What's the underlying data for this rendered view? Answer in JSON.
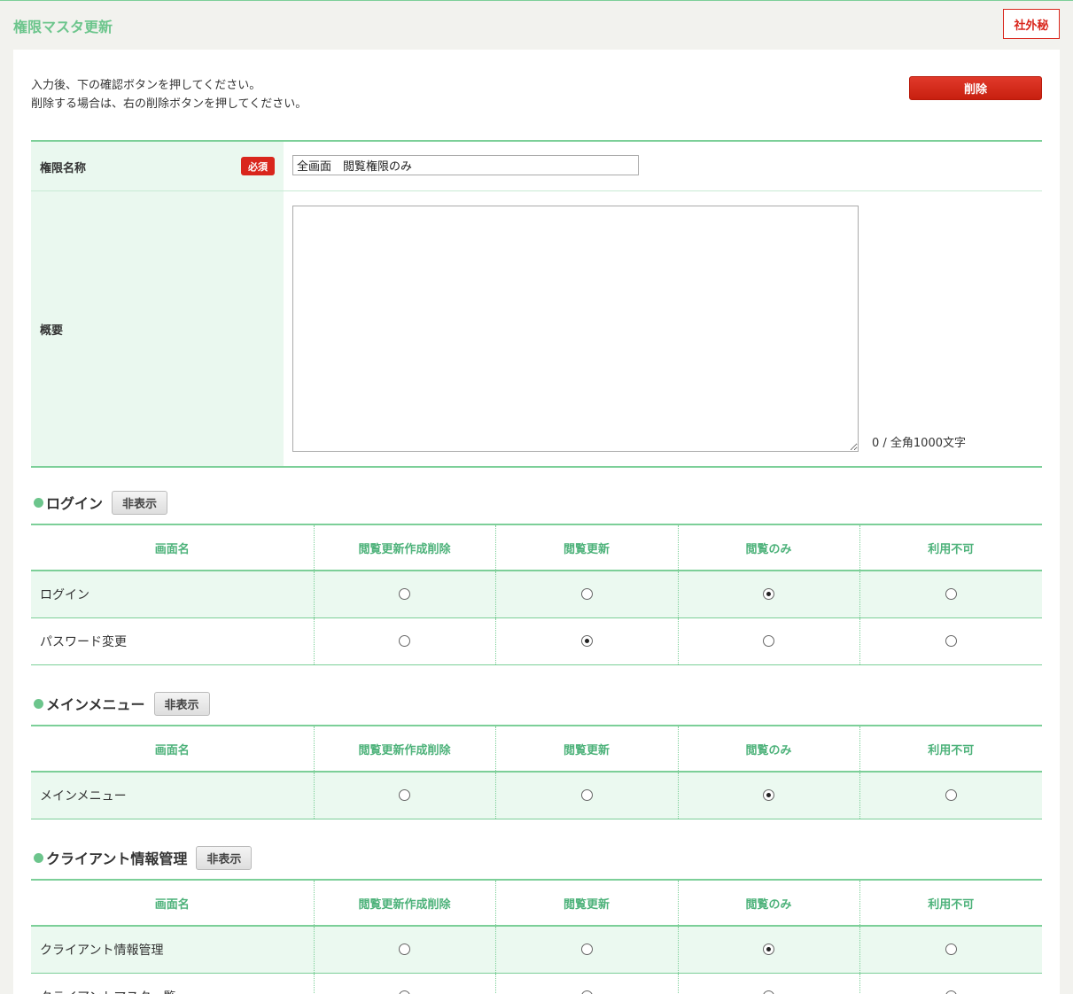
{
  "page": {
    "title": "権限マスタ更新",
    "confidential": "社外秘"
  },
  "instructions": {
    "line1": "入力後、下の確認ボタンを押してください。",
    "line2": "削除する場合は、右の削除ボタンを押してください。"
  },
  "delete_button": "削除",
  "form": {
    "name_label": "権限名称",
    "required": "必須",
    "name_value": "全画面　閲覧権限のみ",
    "summary_label": "概要",
    "summary_value": "",
    "char_count": "0 / 全角1000文字"
  },
  "columns": [
    "画面名",
    "閲覧更新作成削除",
    "閲覧更新",
    "閲覧のみ",
    "利用不可"
  ],
  "hide_label": "非表示",
  "sections": [
    {
      "title": "ログイン",
      "rows": [
        {
          "name": "ログイン",
          "selected": 2
        },
        {
          "name": "パスワード変更",
          "selected": 1
        }
      ]
    },
    {
      "title": "メインメニュー",
      "rows": [
        {
          "name": "メインメニュー",
          "selected": 2
        }
      ]
    },
    {
      "title": "クライアント情報管理",
      "rows": [
        {
          "name": "クライアント情報管理",
          "selected": 2
        },
        {
          "name": "クライアントマスタ一覧",
          "selected": 2
        }
      ]
    }
  ]
}
